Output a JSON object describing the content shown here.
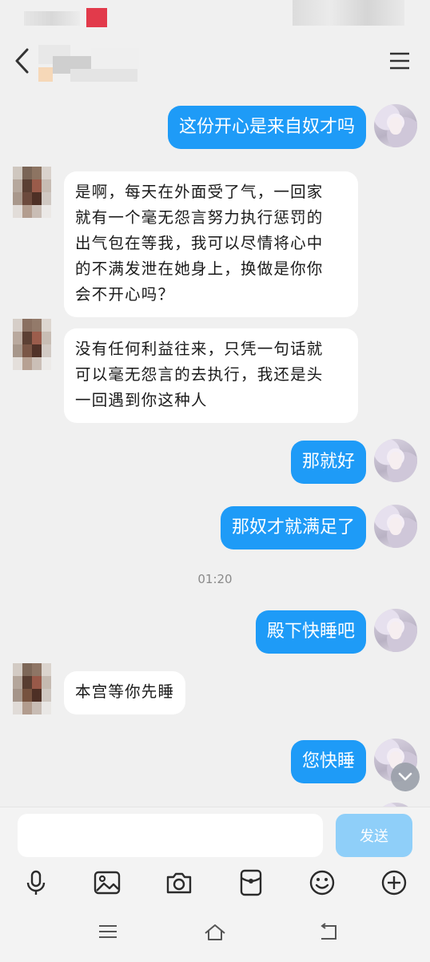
{
  "colors": {
    "self_bubble": "#1e9bf7",
    "other_bubble": "#ffffff",
    "background": "#f0f0f0",
    "send_button": "#8fcff9"
  },
  "header": {
    "back_icon": "back-arrow-icon",
    "menu_icon": "hamburger-menu-icon"
  },
  "messages": [
    {
      "side": "self",
      "text": "这份开心是来自奴才吗"
    },
    {
      "side": "other",
      "lines": [
        "是啊，每天在外面受了气，一回家",
        "就有一个毫无怨言努力执行惩罚的",
        "出气包在等我，我可以尽情将心中",
        "的不满发泄在她身上，换做是你你",
        "会不开心吗？"
      ]
    },
    {
      "side": "other",
      "lines": [
        "没有任何利益往来，只凭一句话就",
        "可以毫无怨言的去执行，我还是头",
        "一回遇到你这种人"
      ]
    },
    {
      "side": "self",
      "text": "那就好"
    },
    {
      "side": "self",
      "text": "那奴才就满足了"
    },
    {
      "side": "time",
      "text": "01:20"
    },
    {
      "side": "self",
      "text": "殿下快睡吧"
    },
    {
      "side": "other",
      "lines": [
        "本宫等你先睡"
      ]
    },
    {
      "side": "self",
      "text": "您快睡"
    }
  ],
  "input": {
    "value": "",
    "placeholder": "",
    "send_label": "发送"
  },
  "toolbar": [
    "microphone-icon",
    "image-icon",
    "camera-icon",
    "red-packet-icon",
    "emoji-icon",
    "plus-icon"
  ],
  "navbar": [
    "recent-apps-icon",
    "home-icon",
    "back-icon"
  ]
}
